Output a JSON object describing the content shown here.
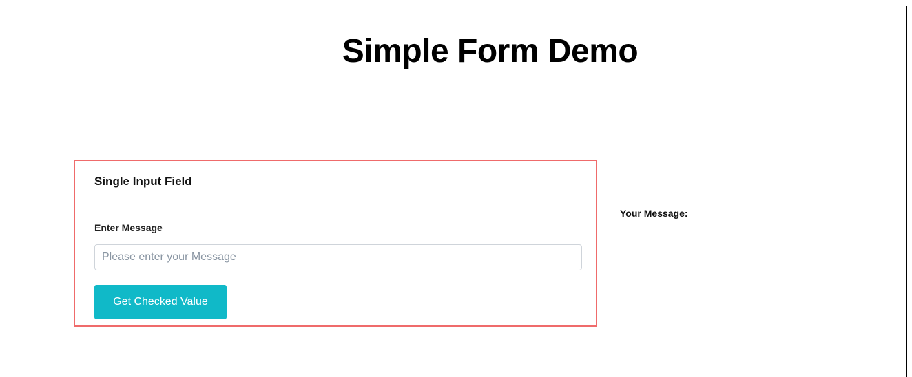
{
  "page": {
    "title": "Simple Form Demo"
  },
  "single_input": {
    "card_title": "Single Input Field",
    "field_label": "Enter Message",
    "input_value": "",
    "input_placeholder": "Please enter your Message",
    "button_label": "Get Checked Value"
  },
  "output": {
    "label": "Your Message:",
    "value": ""
  },
  "colors": {
    "card_border": "#ef6b6b",
    "button_background": "#10b9c8",
    "button_text": "#ffffff",
    "input_border": "#cfd4da",
    "placeholder": "#8a96a3"
  }
}
